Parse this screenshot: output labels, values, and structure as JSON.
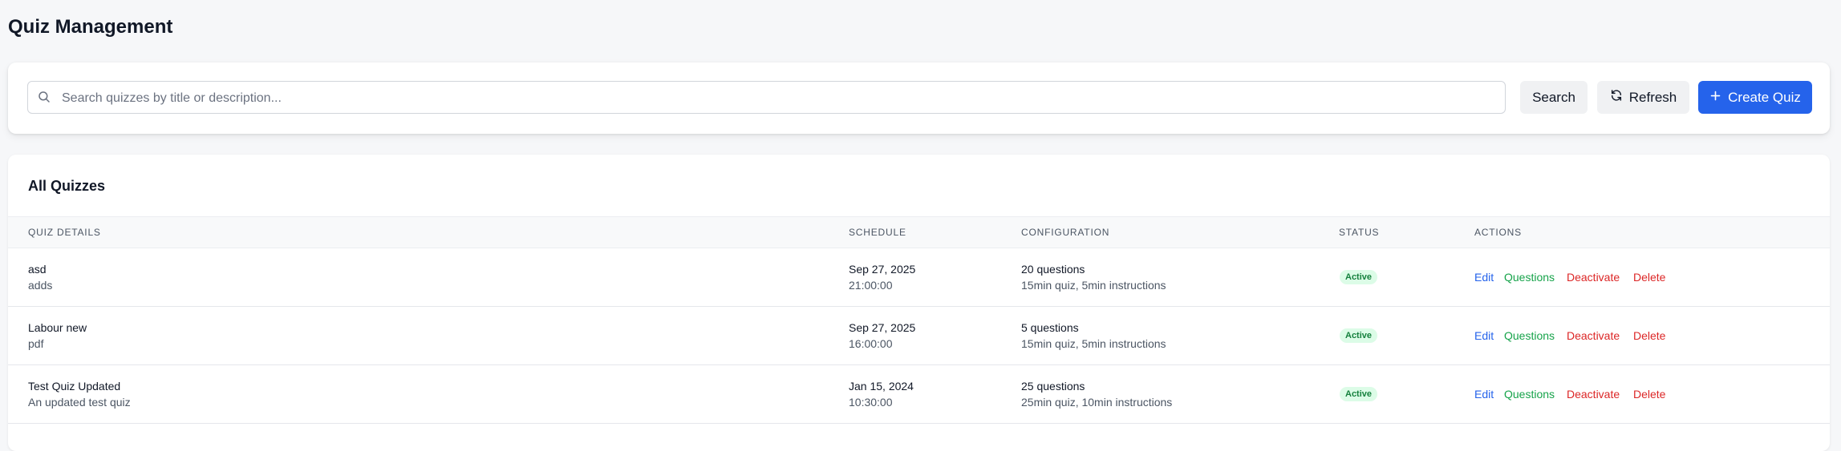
{
  "page": {
    "title": "Quiz Management"
  },
  "toolbar": {
    "search_placeholder": "Search quizzes by title or description...",
    "search_value": "",
    "search_label": "Search",
    "refresh_label": "Refresh",
    "create_label": "Create Quiz"
  },
  "table": {
    "title": "All Quizzes",
    "headers": {
      "details": "Quiz Details",
      "schedule": "Schedule",
      "configuration": "Configuration",
      "status": "Status",
      "actions": "Actions"
    },
    "rows": [
      {
        "title": "asd",
        "description": "adds",
        "date": "Sep 27, 2025",
        "time": "21:00:00",
        "questions": "20 questions",
        "durations": "15min quiz, 5min instructions",
        "status": "Active"
      },
      {
        "title": "Labour new",
        "description": "pdf",
        "date": "Sep 27, 2025",
        "time": "16:00:00",
        "questions": "5 questions",
        "durations": "15min quiz, 5min instructions",
        "status": "Active"
      },
      {
        "title": "Test Quiz Updated",
        "description": "An updated test quiz",
        "date": "Jan 15, 2024",
        "time": "10:30:00",
        "questions": "25 questions",
        "durations": "25min quiz, 10min instructions",
        "status": "Active"
      }
    ],
    "actions": {
      "edit": "Edit",
      "questions": "Questions",
      "deactivate": "Deactivate",
      "delete": "Delete"
    }
  },
  "colors": {
    "primary": "#2563eb",
    "success": "#16a34a",
    "danger": "#dc2626",
    "badge_bg": "#dcfce7"
  },
  "icons": [
    "search-icon",
    "refresh-icon",
    "plus-icon"
  ]
}
